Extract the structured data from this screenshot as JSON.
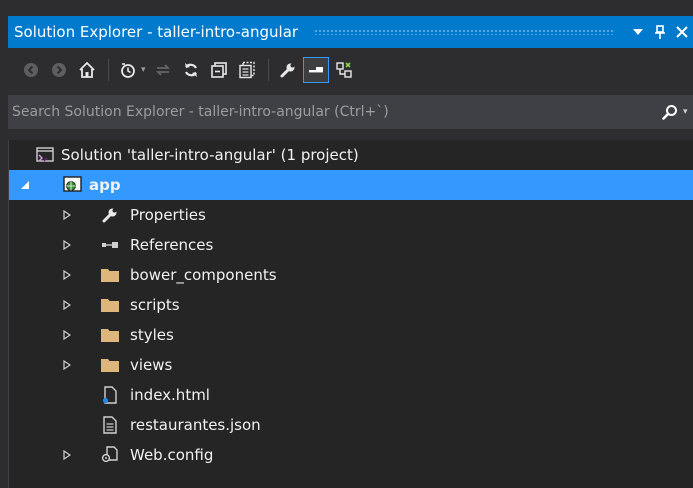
{
  "window": {
    "title": "Solution Explorer - taller-intro-angular",
    "buttons": {
      "dropdown": "▼",
      "pin": "📌",
      "close": "✕"
    }
  },
  "toolbar": {
    "buttons": [
      {
        "name": "back-button",
        "icon": "back-arrow-icon"
      },
      {
        "name": "forward-button",
        "icon": "forward-arrow-icon"
      },
      {
        "name": "home-button",
        "icon": "home-icon"
      },
      {
        "name": "pending-changes-filter-button",
        "icon": "clock-icon"
      },
      {
        "name": "sync-active-document-button",
        "icon": "sync-icon"
      },
      {
        "name": "refresh-button",
        "icon": "refresh-icon"
      },
      {
        "name": "collapse-all-button",
        "icon": "collapse-all-icon"
      },
      {
        "name": "show-all-files-button",
        "icon": "show-all-files-icon"
      },
      {
        "name": "properties-button",
        "icon": "wrench-icon"
      },
      {
        "name": "preview-selected-items-button",
        "icon": "preview-icon"
      },
      {
        "name": "class-view-button",
        "icon": "class-diagram-icon"
      }
    ]
  },
  "search": {
    "placeholder": "Search Solution Explorer - taller-intro-angular (Ctrl+`)",
    "value": ""
  },
  "tree": {
    "solution": {
      "label": "Solution 'taller-intro-angular' (1 project)",
      "icon": "solution-icon"
    },
    "project": {
      "label": "app",
      "icon": "web-project-icon",
      "expanded": true,
      "selected": true
    },
    "items": [
      {
        "label": "Properties",
        "icon": "wrench-icon",
        "expandable": true
      },
      {
        "label": "References",
        "icon": "references-icon",
        "expandable": true
      },
      {
        "label": "bower_components",
        "icon": "folder-icon",
        "expandable": true
      },
      {
        "label": "scripts",
        "icon": "folder-icon",
        "expandable": true
      },
      {
        "label": "styles",
        "icon": "folder-icon",
        "expandable": true
      },
      {
        "label": "views",
        "icon": "folder-icon",
        "expandable": true
      },
      {
        "label": "index.html",
        "icon": "html-file-icon",
        "expandable": false
      },
      {
        "label": "restaurantes.json",
        "icon": "json-file-icon",
        "expandable": false
      },
      {
        "label": "Web.config",
        "icon": "config-file-icon",
        "expandable": true
      }
    ]
  },
  "colors": {
    "accent": "#007acc",
    "selection": "#3399ff",
    "folder": "#dcb67a",
    "background": "#252526",
    "chrome": "#2d2d30"
  }
}
